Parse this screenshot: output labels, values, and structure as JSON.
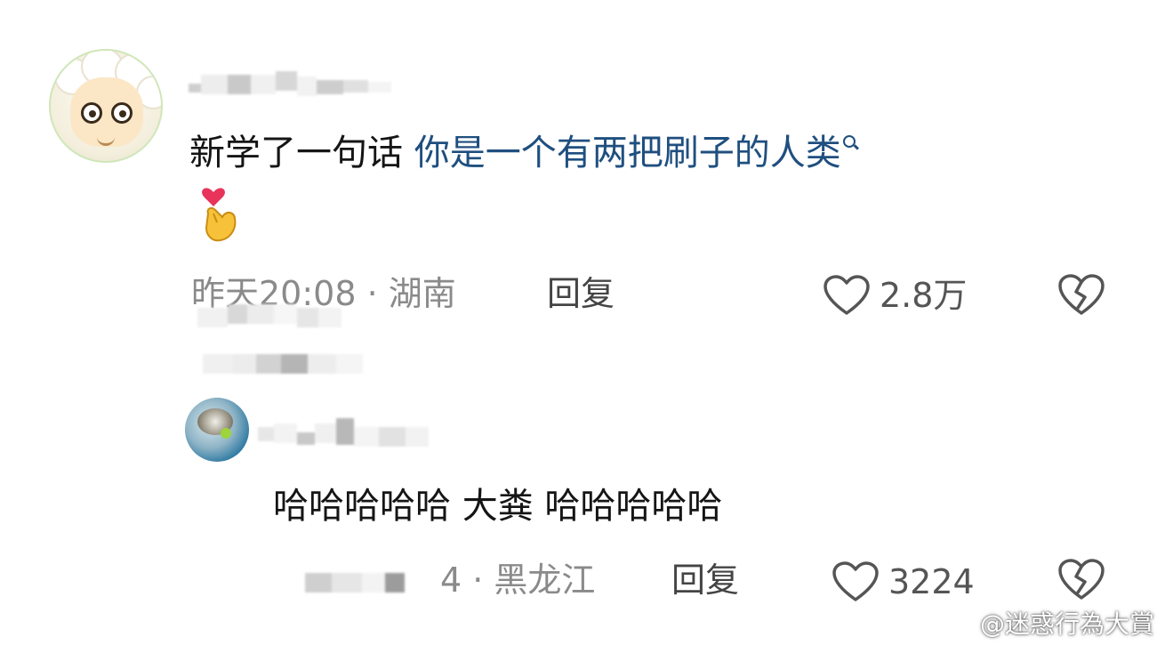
{
  "comment1": {
    "text_plain": "新学了一句话 ",
    "text_link": "你是一个有两把刷子的人类",
    "emoji": "🫰",
    "meta": "昨天20:08 · 湖南",
    "reply_label": "回复",
    "like_count": "2.8万"
  },
  "comment2": {
    "text": "哈哈哈哈哈 大粪  哈哈哈哈哈",
    "meta": "4 · 黑龙江",
    "reply_label": "回复",
    "like_count": "3224"
  },
  "watermark": {
    "text": "@迷惑行為大賞"
  },
  "colors": {
    "link": "#1f4f7f",
    "meta": "#8a8a8a",
    "text": "#151515"
  }
}
